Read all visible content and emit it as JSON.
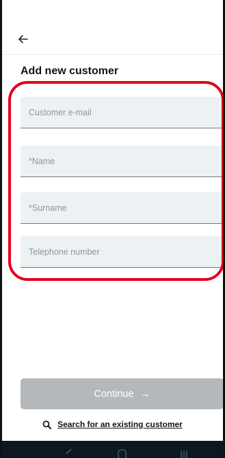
{
  "header": {
    "back_icon": "arrow-left-icon"
  },
  "page": {
    "title": "Add new customer"
  },
  "form": {
    "fields": [
      {
        "placeholder": "Customer e-mail",
        "value": ""
      },
      {
        "placeholder": "*Name",
        "value": ""
      },
      {
        "placeholder": "*Surname",
        "value": ""
      },
      {
        "placeholder": "Telephone number",
        "value": ""
      }
    ]
  },
  "actions": {
    "continue_label": "Continue",
    "continue_icon": "arrow-right-icon",
    "search_label": "Search for an existing customer",
    "search_icon": "search-icon"
  },
  "colors": {
    "highlight": "#e3001b",
    "field_bg": "#ecf1f4",
    "button_disabled": "#b4b8bb",
    "navbar": "#0c1721"
  }
}
